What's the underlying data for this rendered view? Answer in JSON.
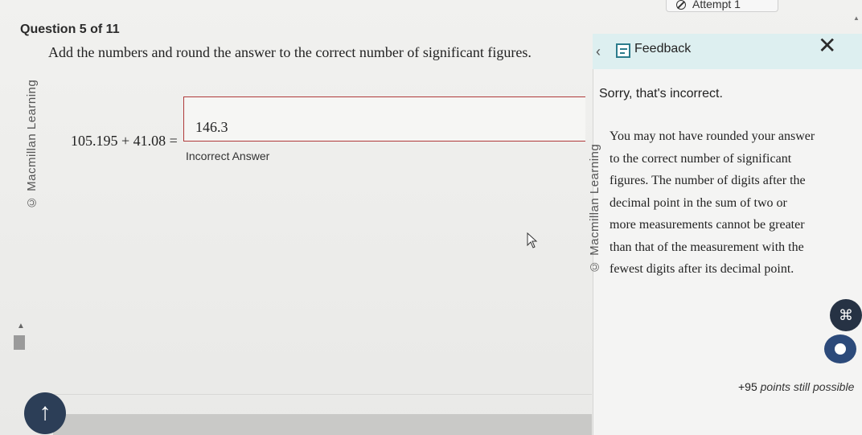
{
  "header": {
    "attempt_label": "Attempt 1",
    "question_counter": "Question 5 of 11"
  },
  "question": {
    "prompt": "Add the numbers and round the answer to the correct number of significant figures.",
    "equation": "105.195 + 41.08 =",
    "answer_value": "146.3",
    "answer_status": "Incorrect Answer",
    "watermark": "© Macmillan Learning"
  },
  "feedback": {
    "title": "Feedback",
    "status": "Sorry, that's incorrect.",
    "message_lines": [
      "You may not have rounded your answer",
      "to the correct number of significant",
      "figures. The number of digits after the",
      "decimal point in the sum of two or",
      "more measurements cannot be greater",
      "than that of the measurement with the",
      "fewest digits after its decimal point."
    ],
    "watermark": "© Macmillan Learning"
  },
  "footer": {
    "points_value": "+95",
    "points_text": "points still possible"
  },
  "icons": {
    "attempt": "circle-slash-icon",
    "feedback_back": "chevron-left-icon",
    "feedback": "feedback-icon",
    "close": "close-icon",
    "tools": "grid-icon",
    "toggle": "toggle-icon",
    "scroll_top": "arrow-up-icon"
  }
}
